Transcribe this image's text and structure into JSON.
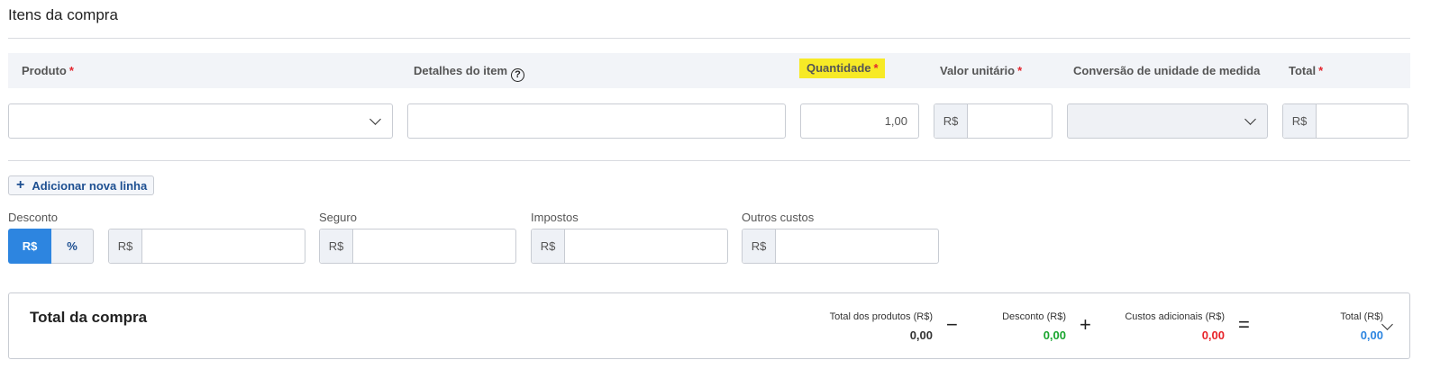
{
  "section": {
    "title": "Itens da compra"
  },
  "columns": {
    "produto": "Produto",
    "detalhes": "Detalhes do item",
    "quantidade": "Quantidade",
    "valor_unitario": "Valor unitário",
    "conversao": "Conversão de unidade de medida",
    "total": "Total",
    "required_mark": "*",
    "help_icon": "?"
  },
  "row": {
    "quantidade_value": "1,00",
    "currency_prefix": "R$"
  },
  "actions": {
    "add_line": "Adicionar nova linha",
    "add_icon": "+"
  },
  "extras": {
    "desconto_label": "Desconto",
    "toggle_rs": "R$",
    "toggle_pct": "%",
    "seguro_label": "Seguro",
    "impostos_label": "Impostos",
    "outros_label": "Outros custos",
    "currency_prefix": "R$"
  },
  "summary": {
    "title": "Total da compra",
    "produtos_label": "Total dos produtos (R$)",
    "produtos_value": "0,00",
    "minus": "−",
    "desconto_label": "Desconto (R$)",
    "desconto_value": "0,00",
    "plus": "+",
    "custos_label": "Custos adicionais (R$)",
    "custos_value": "0,00",
    "equals": "=",
    "total_label": "Total (R$)",
    "total_value": "0,00"
  },
  "colors": {
    "accent": "#2d85e0",
    "highlight": "#f7ea26",
    "required": "#e3262f",
    "discount_green": "#1aa52f",
    "costs_red": "#e8242a",
    "total_blue": "#2d85e0"
  }
}
